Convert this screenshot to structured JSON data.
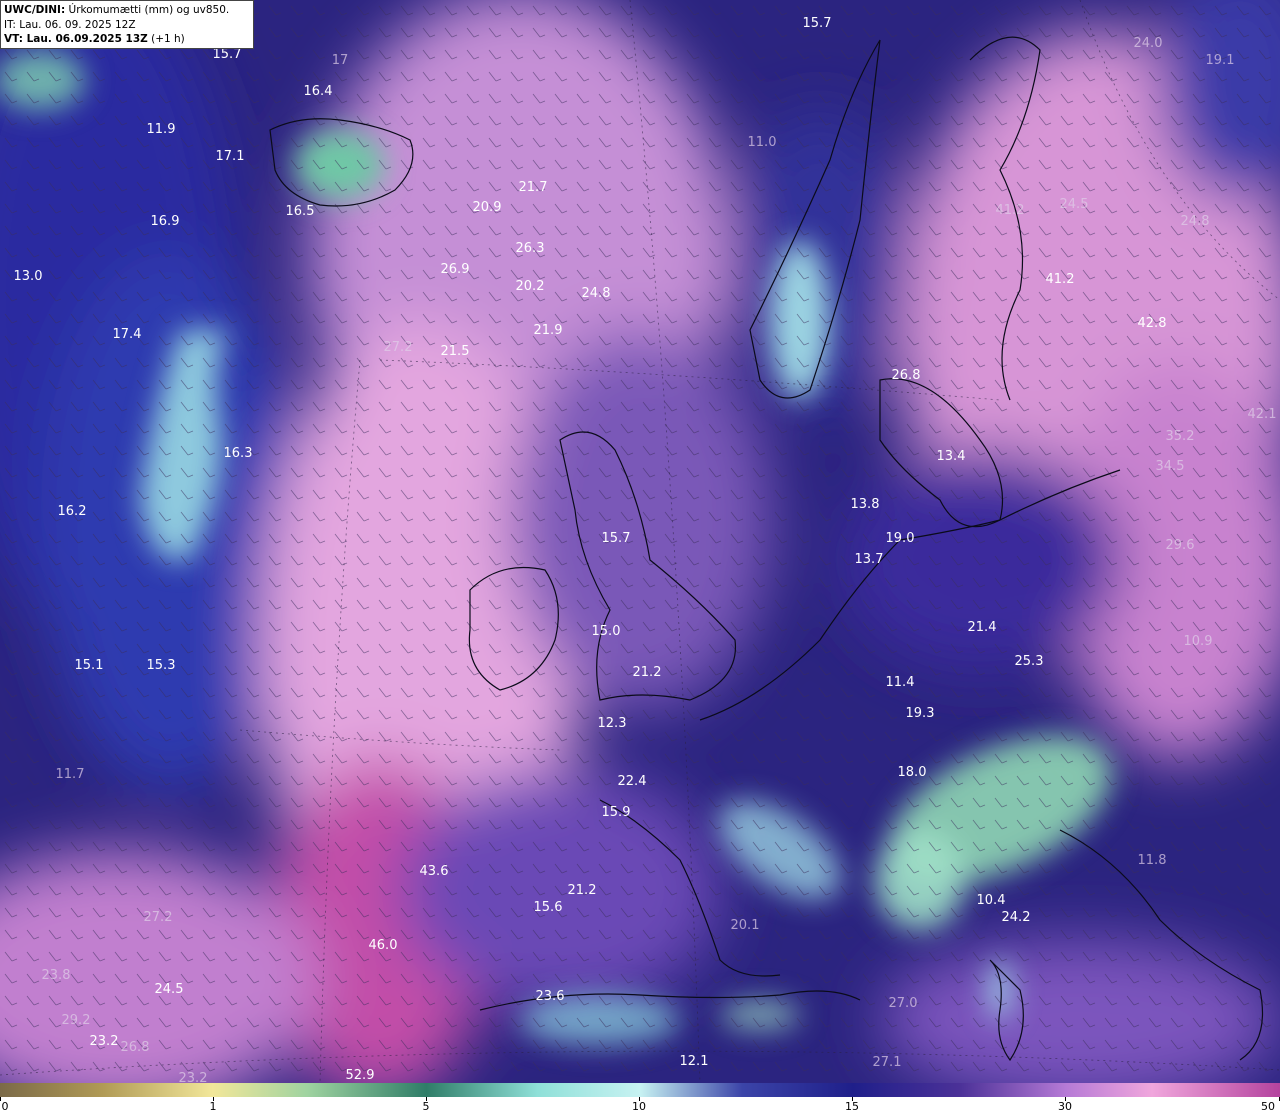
{
  "header": {
    "title_bold": "UWC/DINI:",
    "title_rest": " Úrkomumætti (mm) og uv850.",
    "it_line": "IT: Lau. 06. 09. 2025 12Z",
    "vt_bold": "VT: Lau. 06.09.2025 13Z",
    "vt_rest": " (+1 h)"
  },
  "colorbar": {
    "ticks": [
      "0",
      "1",
      "5",
      "10",
      "15",
      "30",
      "50"
    ]
  },
  "map_values": [
    "15.7",
    "17",
    "16.4",
    "11.9",
    "17.1",
    "16.9",
    "16.5",
    "13.0",
    "17.4",
    "16.3",
    "16.2",
    "15.1",
    "15.3",
    "11.7",
    "15.7",
    "19.1",
    "24.0",
    "11.0",
    "21.7",
    "20.9",
    "26.3",
    "26.9",
    "20.2",
    "24.8",
    "21.9",
    "27.2",
    "21.5",
    "41.2",
    "24.5",
    "24.8",
    "41.2",
    "42.8",
    "42.1",
    "26.8",
    "35.2",
    "34.5",
    "13.4",
    "29.6",
    "13.8",
    "19.0",
    "13.7",
    "15.7",
    "15.0",
    "21.2",
    "21.4",
    "25.3",
    "11.4",
    "19.3",
    "10.9",
    "12.3",
    "22.4",
    "18.0",
    "15.9",
    "43.6",
    "21.2",
    "15.6",
    "27.2",
    "46.0",
    "20.1",
    "10.4",
    "24.2",
    "11.8",
    "23.8",
    "24.5",
    "29.2",
    "23.2",
    "26.8",
    "23.6",
    "12.1",
    "52.9",
    "23.2",
    "27.0",
    "27.1"
  ],
  "colors": {
    "scale": [
      "#7b6a48",
      "#f2e79a",
      "#2f7d68",
      "#c7f2f2",
      "#1f1f8a",
      "#b67ad6",
      "#b4439e"
    ]
  }
}
